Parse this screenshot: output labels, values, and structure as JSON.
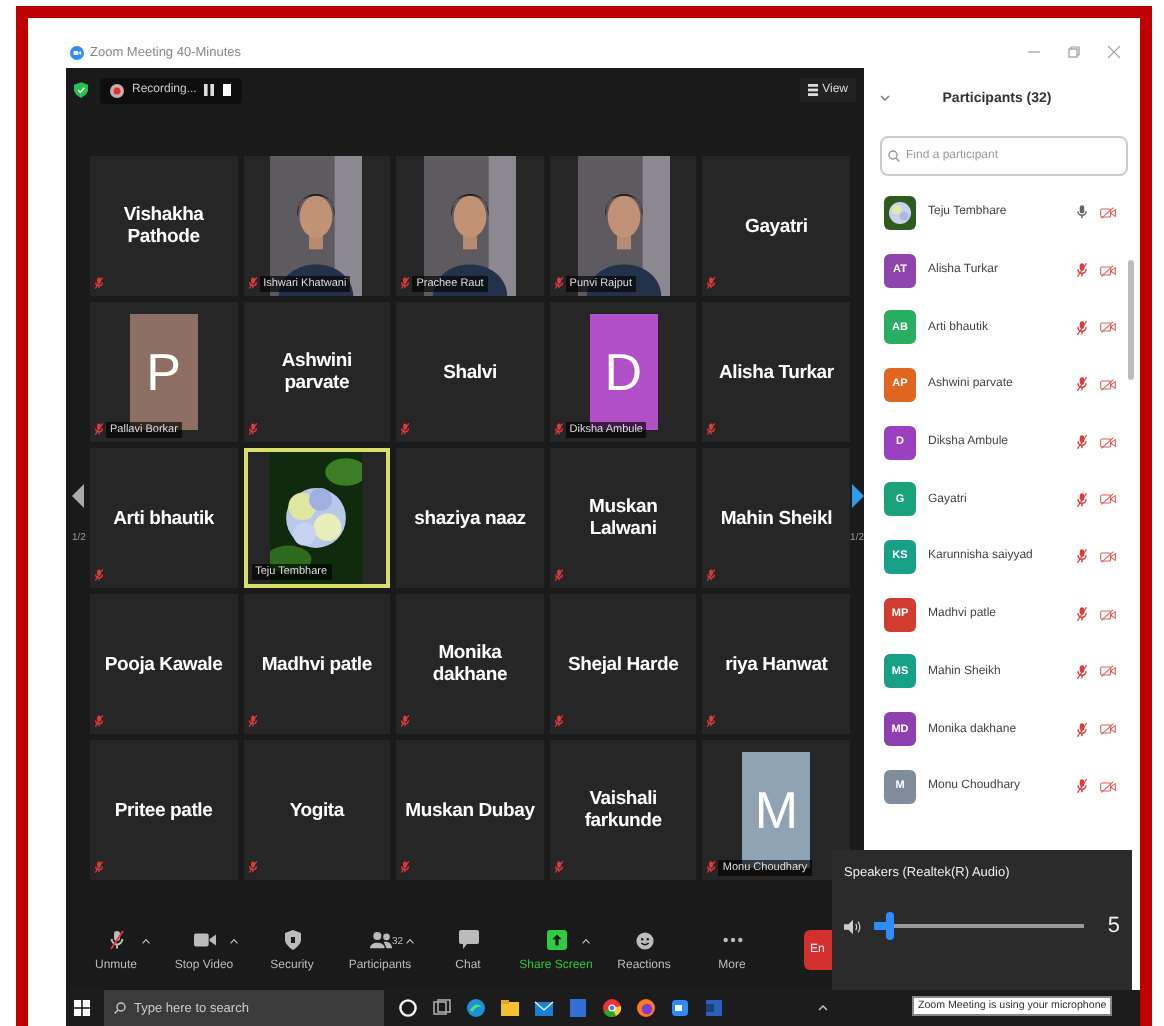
{
  "window": {
    "title": "Zoom Meeting 40-Minutes"
  },
  "meeting_bar": {
    "recording": "Recording...",
    "view": "View"
  },
  "pager": {
    "left": "1/2",
    "right": "1/2"
  },
  "tiles": [
    {
      "kind": "name",
      "name": "Vishakha Pathode",
      "muted": true,
      "speaking": false
    },
    {
      "kind": "video",
      "name": "Ishwari Khatwani",
      "muted": true,
      "speaking": false
    },
    {
      "kind": "video",
      "name": "Prachee Raut",
      "muted": true,
      "speaking": false
    },
    {
      "kind": "video",
      "name": "Punvi Rajput",
      "muted": true,
      "speaking": false
    },
    {
      "kind": "name",
      "name": "Gayatri",
      "muted": true,
      "speaking": false
    },
    {
      "kind": "avatar",
      "letter": "P",
      "color": "#8d6e63",
      "name": "Pallavi Borkar",
      "muted": true,
      "speaking": false
    },
    {
      "kind": "name",
      "name": "Ashwini parvate",
      "muted": true,
      "speaking": false
    },
    {
      "kind": "name",
      "name": "Shalvi",
      "muted": true,
      "speaking": false
    },
    {
      "kind": "avatar",
      "letter": "D",
      "color": "#b04fc6",
      "name": "Diksha Ambule",
      "muted": true,
      "speaking": false
    },
    {
      "kind": "name",
      "name": "Alisha Turkar",
      "muted": true,
      "speaking": false
    },
    {
      "kind": "name",
      "name": "Arti bhautik",
      "muted": true,
      "speaking": false
    },
    {
      "name": "Teju Tembhare",
      "muted": false,
      "speaking": true
    },
    {
      "kind": "name",
      "name": "shaziya naaz",
      "muted": false,
      "speaking": false
    },
    {
      "kind": "name",
      "name": "Muskan Lalwani",
      "muted": true,
      "speaking": false
    },
    {
      "kind": "name",
      "name": "Mahin Sheikl",
      "muted": true,
      "speaking": false
    },
    {
      "kind": "name",
      "name": "Pooja Kawale",
      "muted": true,
      "speaking": false
    },
    {
      "kind": "name",
      "name": "Madhvi patle",
      "muted": true,
      "speaking": false
    },
    {
      "kind": "name",
      "name": "Monika dakhane",
      "muted": true,
      "speaking": false
    },
    {
      "kind": "name",
      "name": "Shejal Harde",
      "muted": true,
      "speaking": false
    },
    {
      "kind": "name",
      "name": "riya Hanwat",
      "muted": true,
      "speaking": false
    },
    {
      "kind": "name",
      "name": "Pritee patle",
      "muted": true,
      "speaking": false
    },
    {
      "kind": "name",
      "name": "Yogita",
      "muted": true,
      "speaking": false
    },
    {
      "kind": "name",
      "name": "Muskan Dubay",
      "muted": true,
      "speaking": false
    },
    {
      "kind": "name",
      "name": "Vaishali farkunde",
      "muted": true,
      "speaking": false
    },
    {
      "kind": "avatar",
      "letter": "M",
      "color": "#8ea3b3",
      "name": "Monu Choudhary",
      "muted": true,
      "speaking": false
    }
  ],
  "participants": {
    "title": "Participants (32)",
    "placeholder": "Find a participant",
    "items": [
      {
        "kind": "picture",
        "name": "Teju Tembhare",
        "mic_muted": false
      },
      {
        "kind": "initials",
        "initials": "AT",
        "color": "#8e44ad",
        "name": "Alisha Turkar",
        "mic_muted": true
      },
      {
        "kind": "initials",
        "initials": "AB",
        "color": "#27ae60",
        "name": "Arti bhautik",
        "mic_muted": true
      },
      {
        "kind": "initials",
        "initials": "AP",
        "color": "#e0661f",
        "name": "Ashwini parvate",
        "mic_muted": true
      },
      {
        "kind": "initials",
        "initials": "D",
        "color": "#9b3fc0",
        "name": "Diksha Ambule",
        "mic_muted": true
      },
      {
        "kind": "initials",
        "initials": "G",
        "color": "#1aa37a",
        "name": "Gayatri",
        "mic_muted": true
      },
      {
        "kind": "initials",
        "initials": "KS",
        "color": "#17a085",
        "name": "Karunnisha saiyyad",
        "mic_muted": true
      },
      {
        "kind": "initials",
        "initials": "MP",
        "color": "#d23c2e",
        "name": "Madhvi patle",
        "mic_muted": true
      },
      {
        "kind": "initials",
        "initials": "MS",
        "color": "#16a085",
        "name": "Mahin Sheikh",
        "mic_muted": true
      },
      {
        "kind": "initials",
        "initials": "MD",
        "color": "#8e3fb0",
        "name": "Monika dakhane",
        "mic_muted": true
      },
      {
        "kind": "initials",
        "initials": "M",
        "color": "#7f8c9a",
        "name": "Monu Choudhary",
        "mic_muted": true
      }
    ]
  },
  "toolbar": [
    {
      "kind": "unmute",
      "label": "Unmute"
    },
    {
      "kind": "video",
      "label": "Stop Video"
    },
    {
      "kind": "security",
      "label": "Security"
    },
    {
      "kind": "participants",
      "label": "Participants",
      "count": "32"
    },
    {
      "kind": "chat",
      "label": "Chat"
    },
    {
      "kind": "share",
      "label": "Share Screen"
    },
    {
      "kind": "reactions",
      "label": "Reactions"
    },
    {
      "kind": "more",
      "label": "More"
    }
  ],
  "end_button": "En",
  "speaker_popup": {
    "title": "Speakers (Realtek(R) Audio)",
    "level": 0.06,
    "reading": "5"
  },
  "taskbar": {
    "placeholder": "Type here to search",
    "tooltip": "Zoom Meeting is using your microphone"
  }
}
